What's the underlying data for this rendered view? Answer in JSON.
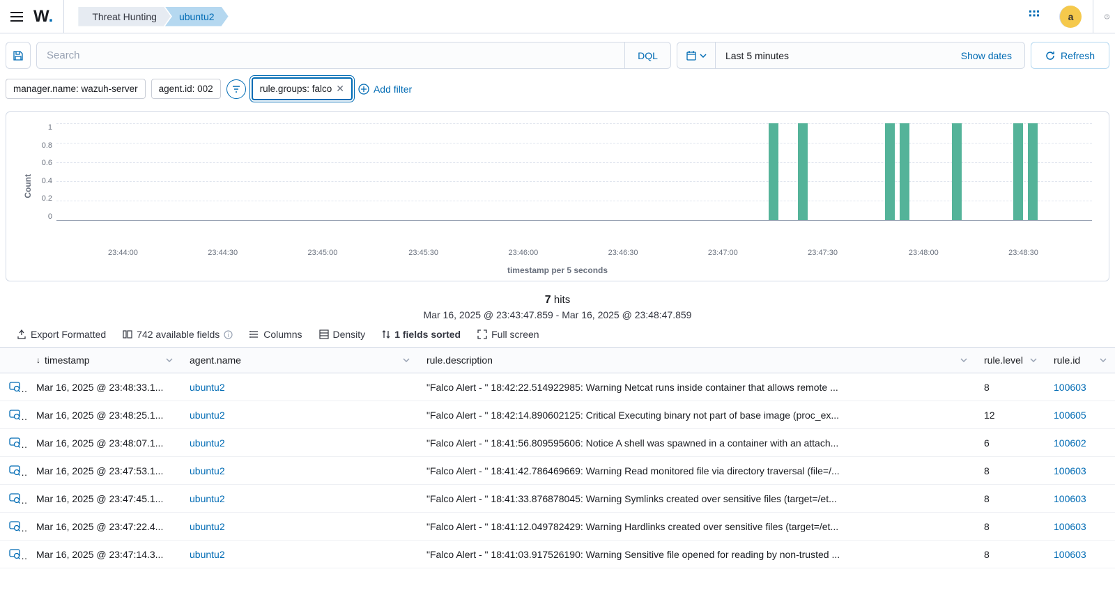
{
  "header": {
    "breadcrumbs": [
      "Threat Hunting",
      "ubuntu2"
    ],
    "avatar_letter": "a"
  },
  "search": {
    "placeholder": "Search",
    "dql_label": "DQL",
    "date_text": "Last 5 minutes",
    "show_dates_label": "Show dates",
    "refresh_label": "Refresh"
  },
  "filters": {
    "pills": [
      {
        "text": "manager.name: wazuh-server",
        "removable": false,
        "highlighted": false
      },
      {
        "text": "agent.id: 002",
        "removable": false,
        "highlighted": false
      },
      {
        "text": "rule.groups: falco",
        "removable": true,
        "highlighted": true
      }
    ],
    "add_filter_label": "Add filter"
  },
  "chart_data": {
    "type": "bar",
    "ylabel": "Count",
    "xlabel": "timestamp per 5 seconds",
    "ylim": [
      0,
      1
    ],
    "y_ticks": [
      "1",
      "0.8",
      "0.6",
      "0.4",
      "0.2",
      "0"
    ],
    "x_ticks": [
      {
        "label": "23:44:00",
        "pos": 6.8
      },
      {
        "label": "23:44:30",
        "pos": 16.4
      },
      {
        "label": "23:45:00",
        "pos": 26.0
      },
      {
        "label": "23:45:30",
        "pos": 35.7
      },
      {
        "label": "23:46:00",
        "pos": 45.3
      },
      {
        "label": "23:46:30",
        "pos": 54.9
      },
      {
        "label": "23:47:00",
        "pos": 64.5
      },
      {
        "label": "23:47:30",
        "pos": 74.1
      },
      {
        "label": "23:48:00",
        "pos": 83.8
      },
      {
        "label": "23:48:30",
        "pos": 93.4
      }
    ],
    "bars": [
      {
        "pos": 68.8,
        "value": 1
      },
      {
        "pos": 71.6,
        "value": 1
      },
      {
        "pos": 80.0,
        "value": 1
      },
      {
        "pos": 81.4,
        "value": 1
      },
      {
        "pos": 86.5,
        "value": 1
      },
      {
        "pos": 92.4,
        "value": 1
      },
      {
        "pos": 93.8,
        "value": 1
      }
    ]
  },
  "hits": {
    "count": "7",
    "count_suffix": " hits",
    "range": "Mar 16, 2025 @ 23:43:47.859 - Mar 16, 2025 @ 23:48:47.859"
  },
  "toolbar": {
    "export": "Export Formatted",
    "fields": "742 available fields",
    "columns": "Columns",
    "density": "Density",
    "sorted": "1 fields sorted",
    "fullscreen": "Full screen"
  },
  "table": {
    "columns": [
      "timestamp",
      "agent.name",
      "rule.description",
      "rule.level",
      "rule.id"
    ],
    "rows": [
      {
        "ts": "Mar 16, 2025 @ 23:48:33.1...",
        "agent": "ubuntu2",
        "desc": "\"Falco Alert - \" 18:42:22.514922985: Warning Netcat runs inside container that allows remote ...",
        "level": "8",
        "id": "100603"
      },
      {
        "ts": "Mar 16, 2025 @ 23:48:25.1...",
        "agent": "ubuntu2",
        "desc": "\"Falco Alert - \" 18:42:14.890602125: Critical Executing binary not part of base image (proc_ex...",
        "level": "12",
        "id": "100605"
      },
      {
        "ts": "Mar 16, 2025 @ 23:48:07.1...",
        "agent": "ubuntu2",
        "desc": "\"Falco Alert - \" 18:41:56.809595606: Notice A shell was spawned in a container with an attach...",
        "level": "6",
        "id": "100602"
      },
      {
        "ts": "Mar 16, 2025 @ 23:47:53.1...",
        "agent": "ubuntu2",
        "desc": "\"Falco Alert - \" 18:41:42.786469669: Warning Read monitored file via directory traversal (file=/...",
        "level": "8",
        "id": "100603"
      },
      {
        "ts": "Mar 16, 2025 @ 23:47:45.1...",
        "agent": "ubuntu2",
        "desc": "\"Falco Alert - \" 18:41:33.876878045: Warning Symlinks created over sensitive files (target=/et...",
        "level": "8",
        "id": "100603"
      },
      {
        "ts": "Mar 16, 2025 @ 23:47:22.4...",
        "agent": "ubuntu2",
        "desc": "\"Falco Alert - \" 18:41:12.049782429: Warning Hardlinks created over sensitive files (target=/et...",
        "level": "8",
        "id": "100603"
      },
      {
        "ts": "Mar 16, 2025 @ 23:47:14.3...",
        "agent": "ubuntu2",
        "desc": "\"Falco Alert - \" 18:41:03.917526190: Warning Sensitive file opened for reading by non-trusted ...",
        "level": "8",
        "id": "100603"
      }
    ]
  }
}
